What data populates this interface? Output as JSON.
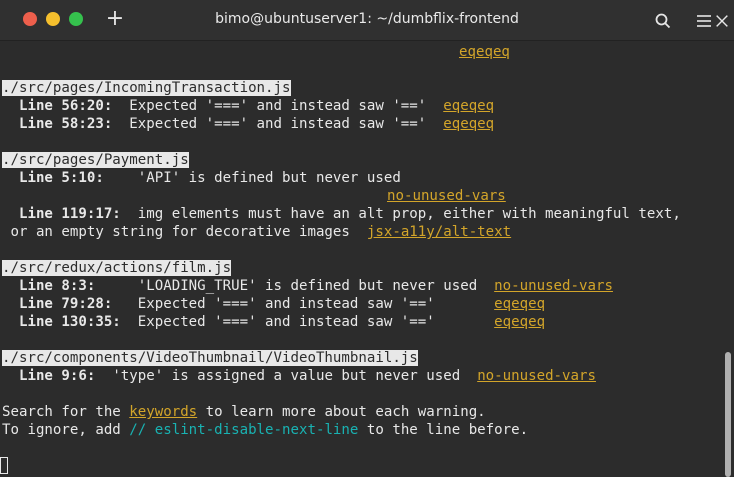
{
  "window": {
    "title": "bimo@ubuntuserver1: ~/dumbflix-frontend"
  },
  "terminal": {
    "top_rule": "eqeqeq",
    "file1": {
      "path": "./src/pages/IncomingTransaction.js",
      "rows": [
        {
          "loc": "  Line 56:20:",
          "msg": "  Expected '===' and instead saw '=='  ",
          "rule": "eqeqeq"
        },
        {
          "loc": "  Line 58:23:",
          "msg": "  Expected '===' and instead saw '=='  ",
          "rule": "eqeqeq"
        }
      ]
    },
    "file2": {
      "path": "./src/pages/Payment.js",
      "row1": {
        "loc": "  Line 5:10:",
        "msg": "    'API' is defined but never used"
      },
      "row1_rule": "no-unused-vars",
      "row2": {
        "loc": "  Line 119:17:",
        "msg": "  img elements must have an alt prop, either with meaningful text,"
      },
      "row2_cont": " or an empty string for decorative images  ",
      "row2_rule": "jsx-a11y/alt-text"
    },
    "file3": {
      "path": "./src/redux/actions/film.js",
      "rows": [
        {
          "loc": "  Line 8:3:",
          "msg": "     'LOADING_TRUE' is defined but never used  ",
          "rule": "no-unused-vars"
        },
        {
          "loc": "  Line 79:28:",
          "msg": "   Expected '===' and instead saw '=='       ",
          "rule": "eqeqeq"
        },
        {
          "loc": "  Line 130:35:",
          "msg": "  Expected '===' and instead saw '=='       ",
          "rule": "eqeqeq"
        }
      ]
    },
    "file4": {
      "path": "./src/components/VideoThumbnail/VideoThumbnail.js",
      "row1": {
        "loc": "  Line 9:6:",
        "msg": "  'type' is assigned a value but never used  ",
        "rule": "no-unused-vars"
      }
    },
    "footer": {
      "search_pre": "Search for the ",
      "search_link": "keywords",
      "search_post": " to learn more about each warning.",
      "ignore_pre": "To ignore, add ",
      "ignore_code": "// eslint-disable-next-line",
      "ignore_post": " to the line before."
    }
  },
  "colors": {
    "background": "#2c2c2c",
    "text": "#e8e8e8",
    "link": "#d3a52a",
    "code": "#19b2b2"
  },
  "icons": [
    "new-tab-icon",
    "search-icon",
    "hamburger-menu-icon",
    "close-icon"
  ]
}
